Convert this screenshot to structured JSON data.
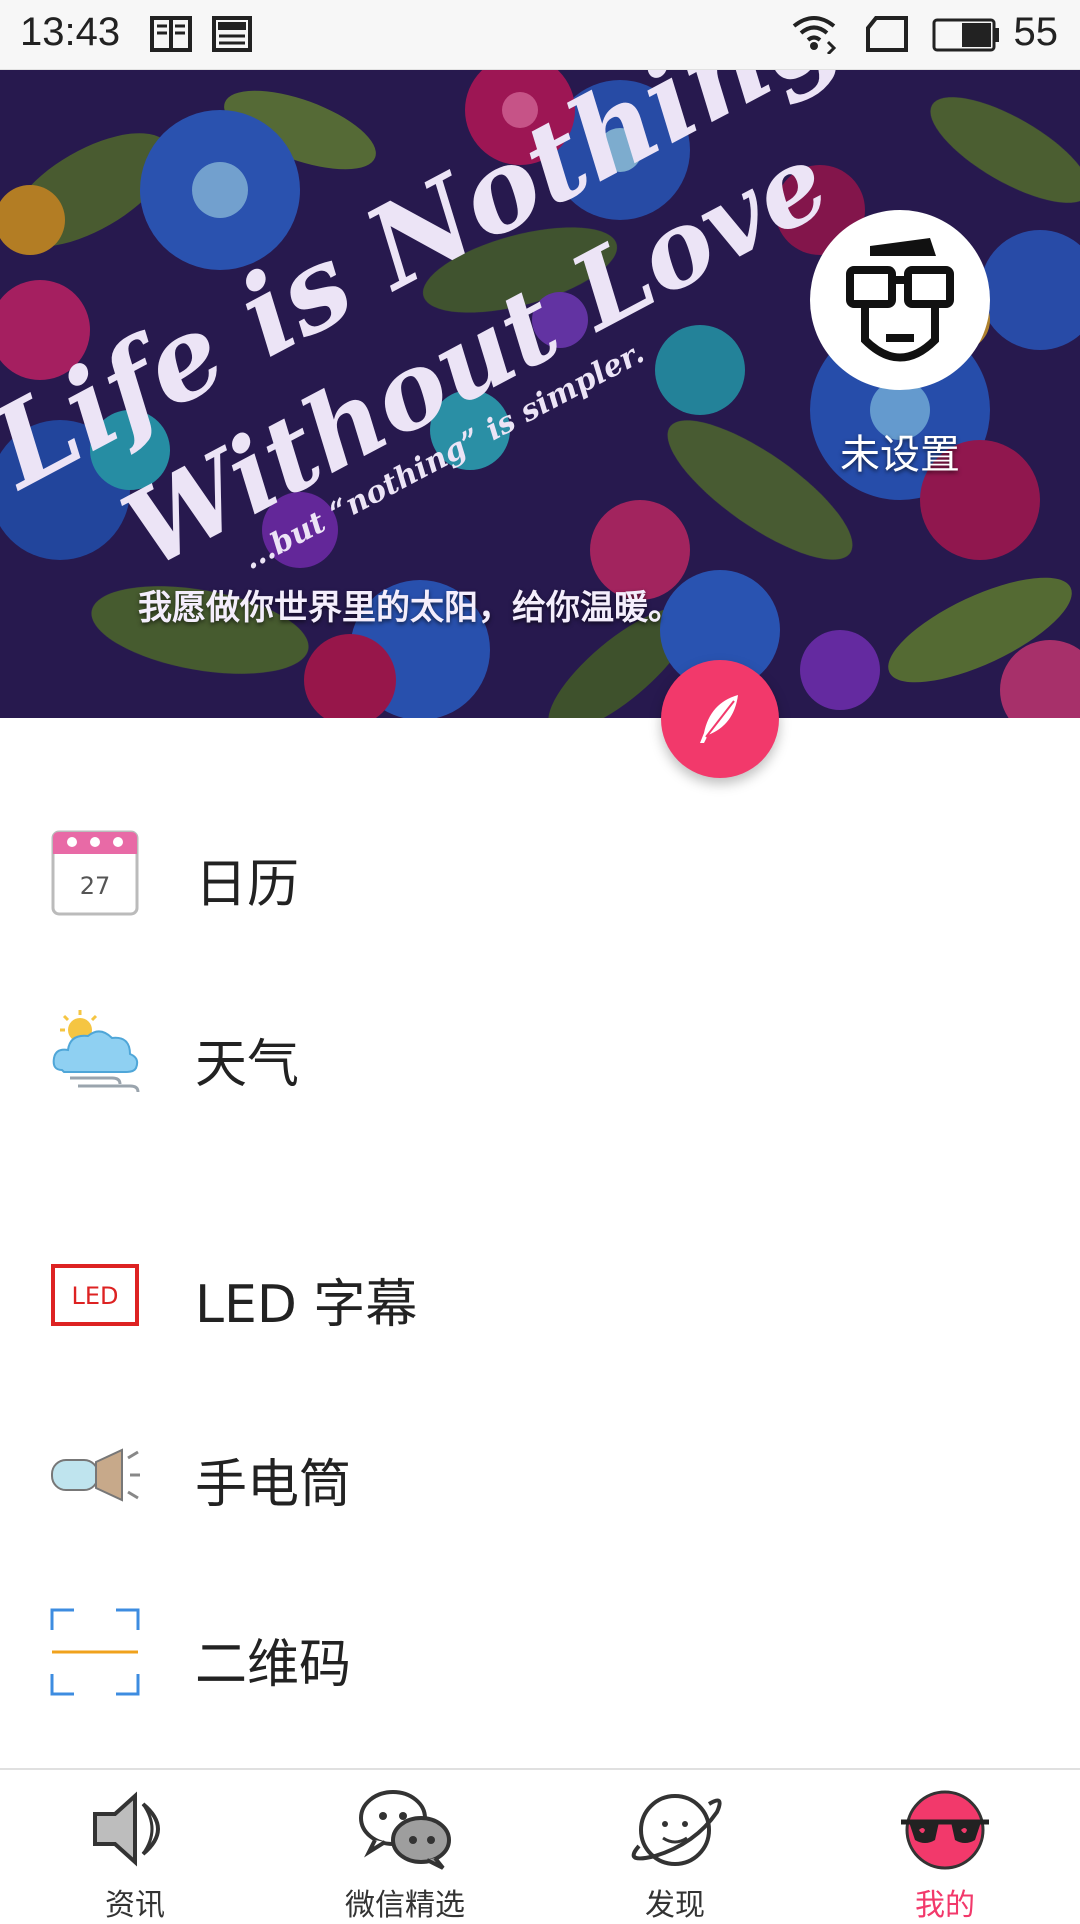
{
  "status_bar": {
    "time": "13:43",
    "battery_text": "55",
    "icons": [
      "reader-icon",
      "news-icon",
      "wifi-icon",
      "sim-icon",
      "battery-icon"
    ]
  },
  "hero": {
    "quote": "我愿做你世界里的太阳，给你温暖。",
    "user_label": "未设置",
    "artwork_lines": [
      "Life is Nothing",
      "Without Love",
      "...but “nothing” is simpler."
    ]
  },
  "menu": {
    "items": [
      {
        "label": "日历",
        "icon": "calendar-icon",
        "calendar_day": "27"
      },
      {
        "label": "天气",
        "icon": "weather-icon"
      },
      {
        "label": "LED 字幕",
        "icon": "led-icon",
        "led_text": "LED"
      },
      {
        "label": "手电筒",
        "icon": "flashlight-icon"
      },
      {
        "label": "二维码",
        "icon": "qr-scan-icon"
      }
    ]
  },
  "bottom_nav": {
    "items": [
      {
        "label": "资讯",
        "icon": "speaker-icon"
      },
      {
        "label": "微信精选",
        "icon": "wechat-icon"
      },
      {
        "label": "发现",
        "icon": "planet-icon"
      },
      {
        "label": "我的",
        "icon": "sunglasses-icon",
        "active": true
      }
    ]
  },
  "colors": {
    "accent": "#f2396b",
    "text": "#222222",
    "statusbar_bg": "#f7f7f7"
  }
}
